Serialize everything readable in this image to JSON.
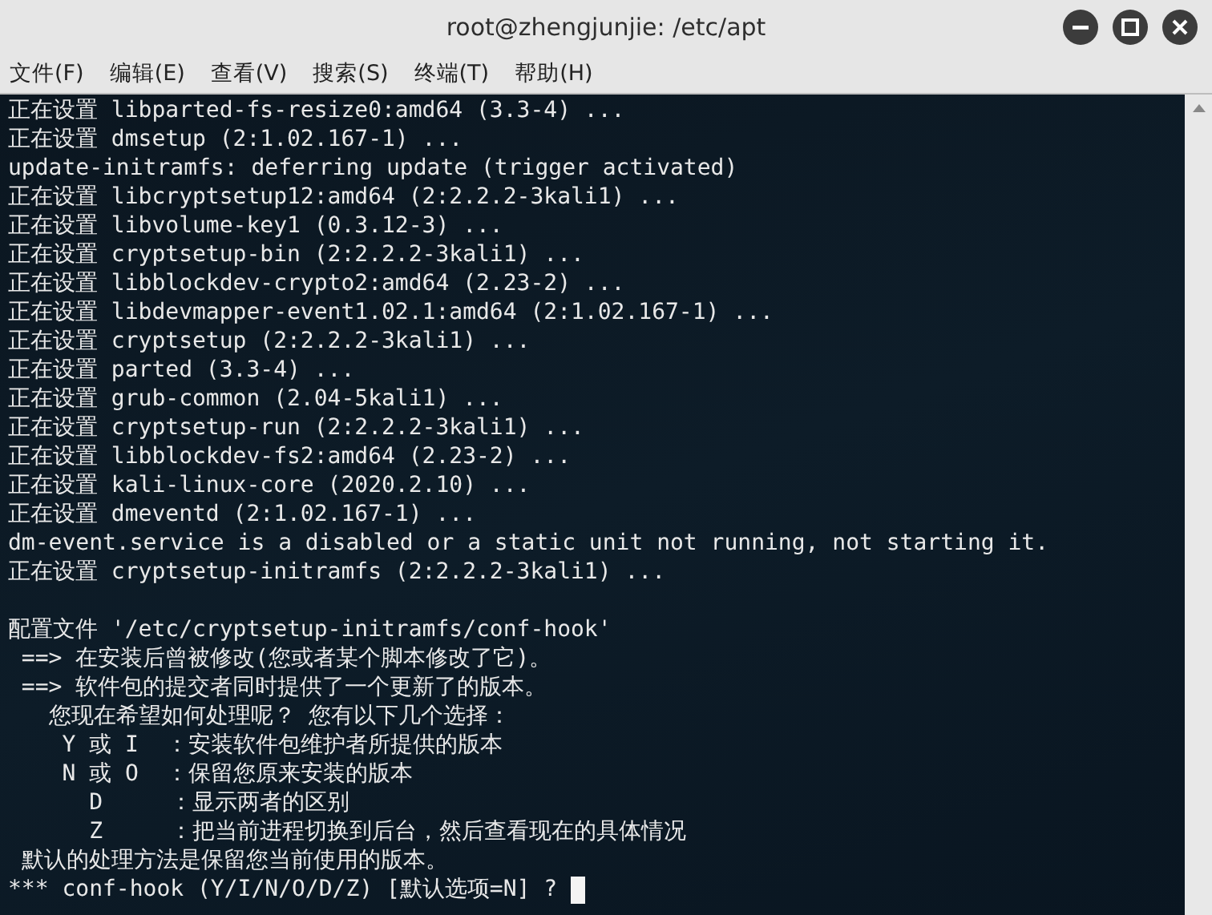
{
  "window": {
    "title": "root@zhengjunjie: /etc/apt"
  },
  "menu": [
    "文件(F)",
    "编辑(E)",
    "查看(V)",
    "搜索(S)",
    "终端(T)",
    "帮助(H)"
  ],
  "terminal": {
    "output_lines": [
      "正在设置 libparted-fs-resize0:amd64 (3.3-4) ...",
      "正在设置 dmsetup (2:1.02.167-1) ...",
      "update-initramfs: deferring update (trigger activated)",
      "正在设置 libcryptsetup12:amd64 (2:2.2.2-3kali1) ...",
      "正在设置 libvolume-key1 (0.3.12-3) ...",
      "正在设置 cryptsetup-bin (2:2.2.2-3kali1) ...",
      "正在设置 libblockdev-crypto2:amd64 (2.23-2) ...",
      "正在设置 libdevmapper-event1.02.1:amd64 (2:1.02.167-1) ...",
      "正在设置 cryptsetup (2:2.2.2-3kali1) ...",
      "正在设置 parted (3.3-4) ...",
      "正在设置 grub-common (2.04-5kali1) ...",
      "正在设置 cryptsetup-run (2:2.2.2-3kali1) ...",
      "正在设置 libblockdev-fs2:amd64 (2.23-2) ...",
      "正在设置 kali-linux-core (2020.2.10) ...",
      "正在设置 dmeventd (2:1.02.167-1) ...",
      "dm-event.service is a disabled or a static unit not running, not starting it.",
      "正在设置 cryptsetup-initramfs (2:2.2.2-3kali1) ..."
    ],
    "prompt_lines": [
      "配置文件 '/etc/cryptsetup-initramfs/conf-hook'",
      " ==> 在安装后曾被修改(您或者某个脚本修改了它)。",
      " ==> 软件包的提交者同时提供了一个更新了的版本。",
      "   您现在希望如何处理呢？ 您有以下几个选择：",
      "    Y 或 I  ：安装软件包维护者所提供的版本",
      "    N 或 O  ：保留您原来安装的版本",
      "      D     ：显示两者的区别",
      "      Z     ：把当前进程切换到后台，然后查看现在的具体情况",
      " 默认的处理方法是保留您当前使用的版本。"
    ],
    "input_prompt": "*** conf-hook (Y/I/N/O/D/Z) [默认选项=N] ? "
  }
}
